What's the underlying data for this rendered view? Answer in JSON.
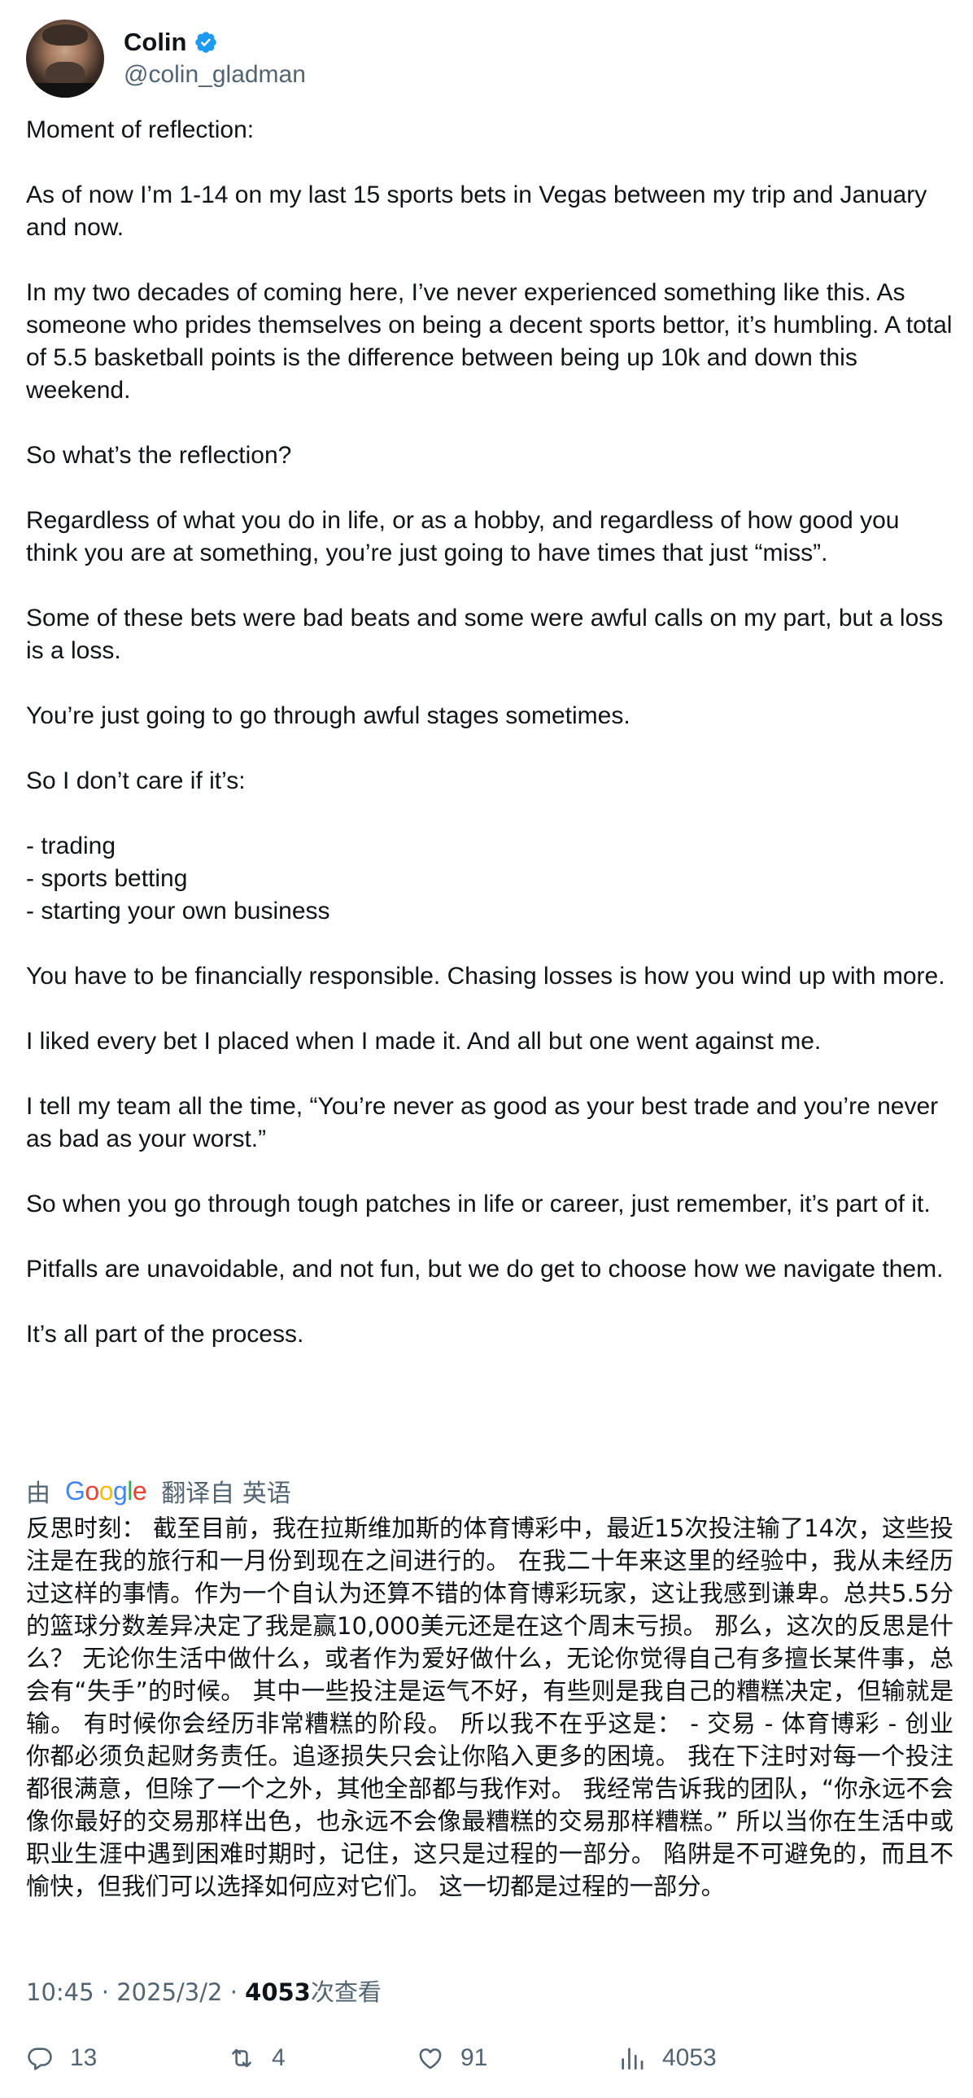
{
  "author": {
    "name": "Colin",
    "handle": "@colin_gladman",
    "verified": true,
    "verified_color": "#1d9bf0"
  },
  "tweet": {
    "paragraphs": [
      "Moment of reflection:",
      "As of now I’m 1-14 on my last 15 sports bets in Vegas between my trip and January and now.",
      "In my two decades of coming here, I’ve never experienced something like this. As someone who prides themselves on being a decent sports bettor, it’s humbling. A total of 5.5 basketball points is the difference between being up 10k and down this weekend.",
      "So what’s the reflection?",
      "Regardless of what you do in life, or as a hobby, and regardless of how good you think you are at something, you’re just going to have times that just “miss”.",
      "Some of these bets were bad beats and some were awful calls on my part, but a loss is a loss.",
      "You’re just going to go through awful stages sometimes.",
      "So I don’t care if it’s:",
      "- trading\n- sports betting\n- starting your own business",
      "You have to be financially responsible.  Chasing losses is how you wind up with more.",
      "I liked every bet I placed when I made it. And all but one went against me.",
      "I tell my team all the time, “You’re never as good as your best trade and you’re never as bad as your worst.”",
      "So when you go through tough patches in life or career, just remember, it’s part of it.",
      "Pitfalls are unavoidable, and not fun, but we do get to choose how we navigate them.",
      "It’s all part of the process."
    ]
  },
  "translation": {
    "prefix": "由",
    "brand": "Google",
    "suffix": "翻译自 英语",
    "text": "反思时刻： 截至目前，我在拉斯维加斯的体育博彩中，最近15次投注输了14次，这些投注是在我的旅行和一月份到现在之间进行的。 在我二十年来这里的经验中，我从未经历过这样的事情。作为一个自认为还算不错的体育博彩玩家，这让我感到谦卑。总共5.5分的篮球分数差异决定了我是赢10,000美元还是在这个周末亏损。 那么，这次的反思是什么？ 无论你生活中做什么，或者作为爱好做什么，无论你觉得自己有多擅长某件事，总会有“失手”的时候。 其中一些投注是运气不好，有些则是我自己的糟糕决定，但输就是输。 有时候你会经历非常糟糕的阶段。 所以我不在乎这是： - 交易 - 体育博彩 - 创业 你都必须负起财务责任。追逐损失只会让你陷入更多的困境。 我在下注时对每一个投注都很满意，但除了一个之外，其他全部都与我作对。 我经常告诉我的团队，“你永远不会像你最好的交易那样出色，也永远不会像最糟糕的交易那样糟糕。” 所以当你在生活中或职业生涯中遇到困难时期时，记住，这只是过程的一部分。 陷阱是不可避免的，而且不愉快，但我们可以选择如何应对它们。 这一切都是过程的一部分。"
  },
  "meta": {
    "time": "10:45",
    "sep1": " · ",
    "date": "2025/3/2",
    "sep2": " · ",
    "views_count": "4053",
    "views_label": "次查看"
  },
  "actions": {
    "replies": "13",
    "reposts": "4",
    "likes": "91",
    "views": "4053",
    "icons": [
      "reply-icon",
      "repost-icon",
      "like-icon",
      "views-icon"
    ],
    "icon_color": "#536471"
  },
  "colors": {
    "text": "#0f1419",
    "secondary": "#536471",
    "google_blue": "#4285f4",
    "google_red": "#ea4335",
    "google_yellow": "#fbbc05",
    "google_green": "#34a853"
  }
}
